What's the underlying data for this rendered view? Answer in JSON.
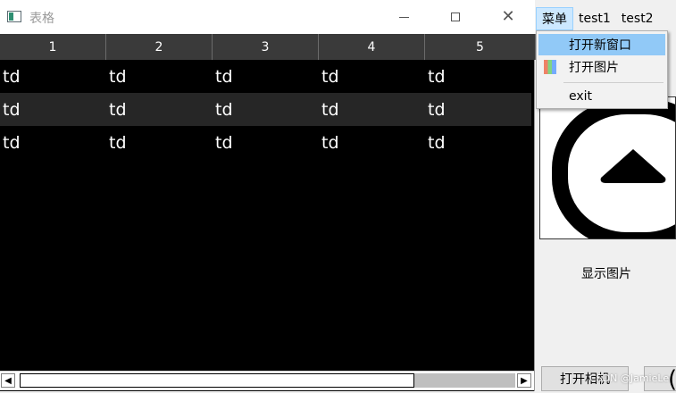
{
  "table_window": {
    "title": "表格",
    "columns": [
      "1",
      "2",
      "3",
      "4",
      "5"
    ],
    "rows": [
      [
        "td",
        "td",
        "td",
        "td",
        "td"
      ],
      [
        "td",
        "td",
        "td",
        "td",
        "td"
      ],
      [
        "td",
        "td",
        "td",
        "td",
        "td"
      ]
    ]
  },
  "menubar": {
    "items": [
      "菜单",
      "test1",
      "test2"
    ]
  },
  "menu_dropdown": {
    "items": [
      "打开新窗口",
      "打开图片",
      "exit"
    ]
  },
  "image_panel": {
    "label": "显示图片"
  },
  "buttons": {
    "open_camera": "打开相机"
  },
  "watermark": "CSDN @JamieLe",
  "colors": {
    "header_bg": "#3a3a3a",
    "alt_row_bg": "#262626",
    "menu_highlight": "#91c9f7"
  }
}
